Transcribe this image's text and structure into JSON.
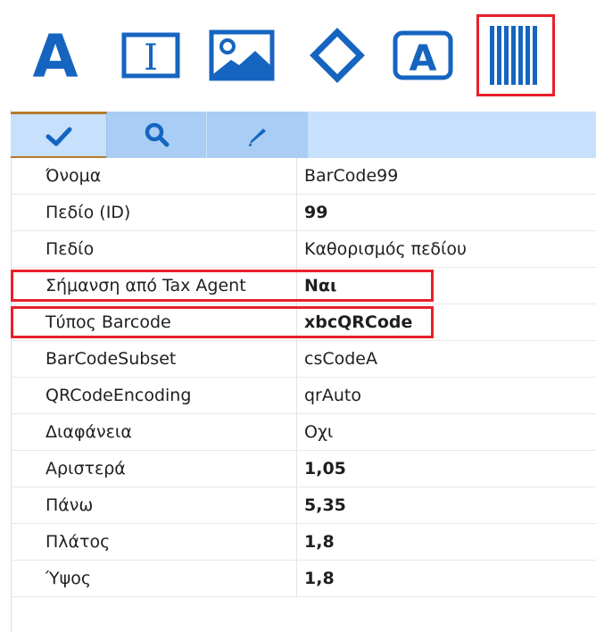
{
  "colors": {
    "icon_blue": "#1565c0",
    "highlight_red": "#e8202a",
    "tab_bar": "#c7e0fb",
    "tab_accent": "#b77a2b"
  },
  "toolbar": {
    "items": [
      {
        "icon": "text-icon",
        "glyph": "A"
      },
      {
        "icon": "textbox-icon",
        "glyph": "I"
      },
      {
        "icon": "image-icon"
      },
      {
        "icon": "shape-diamond-icon"
      },
      {
        "icon": "label-frame-icon",
        "glyph": "A"
      },
      {
        "icon": "barcode-icon",
        "selected": true
      }
    ]
  },
  "tabs": [
    {
      "icon": "checkmark-icon",
      "active": true
    },
    {
      "icon": "search-icon",
      "active": false
    },
    {
      "icon": "pencil-icon",
      "active": false
    }
  ],
  "properties": [
    {
      "name": "Όνομα",
      "value": "BarCode99",
      "bold": false
    },
    {
      "name": "Πεδίο (ID)",
      "value": "99",
      "bold": true
    },
    {
      "name": "Πεδίο",
      "value": "Καθορισμός πεδίου",
      "bold": false
    },
    {
      "name": "Σήμανση από Tax Agent",
      "value": "Ναι",
      "bold": true,
      "highlighted": true
    },
    {
      "name": "Τύπος Barcode",
      "value": "xbcQRCode",
      "bold": true,
      "highlighted": true
    },
    {
      "name": "BarCodeSubset",
      "value": "csCodeA",
      "bold": false
    },
    {
      "name": "QRCodeEncoding",
      "value": "qrAuto",
      "bold": false
    },
    {
      "name": "Διαφάνεια",
      "value": "Οχι",
      "bold": false
    },
    {
      "name": "Αριστερά",
      "value": "1,05",
      "bold": true
    },
    {
      "name": "Πάνω",
      "value": "5,35",
      "bold": true
    },
    {
      "name": "Πλάτος",
      "value": "1,8",
      "bold": true
    },
    {
      "name": "Ύψος",
      "value": "1,8",
      "bold": true
    }
  ]
}
